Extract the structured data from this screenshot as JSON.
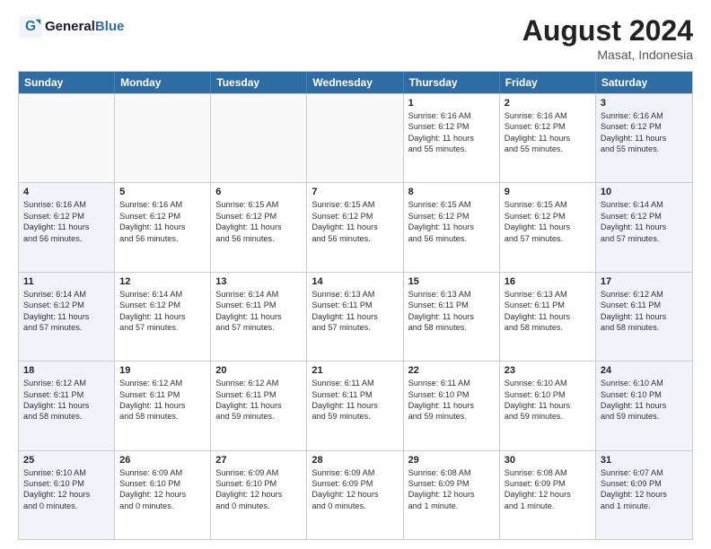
{
  "header": {
    "logo_general": "General",
    "logo_blue": "Blue",
    "month_year": "August 2024",
    "location": "Masat, Indonesia"
  },
  "weekdays": [
    "Sunday",
    "Monday",
    "Tuesday",
    "Wednesday",
    "Thursday",
    "Friday",
    "Saturday"
  ],
  "weeks": [
    [
      {
        "day": "",
        "lines": [],
        "empty": true
      },
      {
        "day": "",
        "lines": [],
        "empty": true
      },
      {
        "day": "",
        "lines": [],
        "empty": true
      },
      {
        "day": "",
        "lines": [],
        "empty": true
      },
      {
        "day": "1",
        "lines": [
          "Sunrise: 6:16 AM",
          "Sunset: 6:12 PM",
          "Daylight: 11 hours",
          "and 55 minutes."
        ]
      },
      {
        "day": "2",
        "lines": [
          "Sunrise: 6:16 AM",
          "Sunset: 6:12 PM",
          "Daylight: 11 hours",
          "and 55 minutes."
        ]
      },
      {
        "day": "3",
        "lines": [
          "Sunrise: 6:16 AM",
          "Sunset: 6:12 PM",
          "Daylight: 11 hours",
          "and 55 minutes."
        ]
      }
    ],
    [
      {
        "day": "4",
        "lines": [
          "Sunrise: 6:16 AM",
          "Sunset: 6:12 PM",
          "Daylight: 11 hours",
          "and 56 minutes."
        ]
      },
      {
        "day": "5",
        "lines": [
          "Sunrise: 6:16 AM",
          "Sunset: 6:12 PM",
          "Daylight: 11 hours",
          "and 56 minutes."
        ]
      },
      {
        "day": "6",
        "lines": [
          "Sunrise: 6:15 AM",
          "Sunset: 6:12 PM",
          "Daylight: 11 hours",
          "and 56 minutes."
        ]
      },
      {
        "day": "7",
        "lines": [
          "Sunrise: 6:15 AM",
          "Sunset: 6:12 PM",
          "Daylight: 11 hours",
          "and 56 minutes."
        ]
      },
      {
        "day": "8",
        "lines": [
          "Sunrise: 6:15 AM",
          "Sunset: 6:12 PM",
          "Daylight: 11 hours",
          "and 56 minutes."
        ]
      },
      {
        "day": "9",
        "lines": [
          "Sunrise: 6:15 AM",
          "Sunset: 6:12 PM",
          "Daylight: 11 hours",
          "and 57 minutes."
        ]
      },
      {
        "day": "10",
        "lines": [
          "Sunrise: 6:14 AM",
          "Sunset: 6:12 PM",
          "Daylight: 11 hours",
          "and 57 minutes."
        ]
      }
    ],
    [
      {
        "day": "11",
        "lines": [
          "Sunrise: 6:14 AM",
          "Sunset: 6:12 PM",
          "Daylight: 11 hours",
          "and 57 minutes."
        ]
      },
      {
        "day": "12",
        "lines": [
          "Sunrise: 6:14 AM",
          "Sunset: 6:12 PM",
          "Daylight: 11 hours",
          "and 57 minutes."
        ]
      },
      {
        "day": "13",
        "lines": [
          "Sunrise: 6:14 AM",
          "Sunset: 6:11 PM",
          "Daylight: 11 hours",
          "and 57 minutes."
        ]
      },
      {
        "day": "14",
        "lines": [
          "Sunrise: 6:13 AM",
          "Sunset: 6:11 PM",
          "Daylight: 11 hours",
          "and 57 minutes."
        ]
      },
      {
        "day": "15",
        "lines": [
          "Sunrise: 6:13 AM",
          "Sunset: 6:11 PM",
          "Daylight: 11 hours",
          "and 58 minutes."
        ]
      },
      {
        "day": "16",
        "lines": [
          "Sunrise: 6:13 AM",
          "Sunset: 6:11 PM",
          "Daylight: 11 hours",
          "and 58 minutes."
        ]
      },
      {
        "day": "17",
        "lines": [
          "Sunrise: 6:12 AM",
          "Sunset: 6:11 PM",
          "Daylight: 11 hours",
          "and 58 minutes."
        ]
      }
    ],
    [
      {
        "day": "18",
        "lines": [
          "Sunrise: 6:12 AM",
          "Sunset: 6:11 PM",
          "Daylight: 11 hours",
          "and 58 minutes."
        ]
      },
      {
        "day": "19",
        "lines": [
          "Sunrise: 6:12 AM",
          "Sunset: 6:11 PM",
          "Daylight: 11 hours",
          "and 58 minutes."
        ]
      },
      {
        "day": "20",
        "lines": [
          "Sunrise: 6:12 AM",
          "Sunset: 6:11 PM",
          "Daylight: 11 hours",
          "and 59 minutes."
        ]
      },
      {
        "day": "21",
        "lines": [
          "Sunrise: 6:11 AM",
          "Sunset: 6:11 PM",
          "Daylight: 11 hours",
          "and 59 minutes."
        ]
      },
      {
        "day": "22",
        "lines": [
          "Sunrise: 6:11 AM",
          "Sunset: 6:10 PM",
          "Daylight: 11 hours",
          "and 59 minutes."
        ]
      },
      {
        "day": "23",
        "lines": [
          "Sunrise: 6:10 AM",
          "Sunset: 6:10 PM",
          "Daylight: 11 hours",
          "and 59 minutes."
        ]
      },
      {
        "day": "24",
        "lines": [
          "Sunrise: 6:10 AM",
          "Sunset: 6:10 PM",
          "Daylight: 11 hours",
          "and 59 minutes."
        ]
      }
    ],
    [
      {
        "day": "25",
        "lines": [
          "Sunrise: 6:10 AM",
          "Sunset: 6:10 PM",
          "Daylight: 12 hours",
          "and 0 minutes."
        ]
      },
      {
        "day": "26",
        "lines": [
          "Sunrise: 6:09 AM",
          "Sunset: 6:10 PM",
          "Daylight: 12 hours",
          "and 0 minutes."
        ]
      },
      {
        "day": "27",
        "lines": [
          "Sunrise: 6:09 AM",
          "Sunset: 6:10 PM",
          "Daylight: 12 hours",
          "and 0 minutes."
        ]
      },
      {
        "day": "28",
        "lines": [
          "Sunrise: 6:09 AM",
          "Sunset: 6:09 PM",
          "Daylight: 12 hours",
          "and 0 minutes."
        ]
      },
      {
        "day": "29",
        "lines": [
          "Sunrise: 6:08 AM",
          "Sunset: 6:09 PM",
          "Daylight: 12 hours",
          "and 1 minute."
        ]
      },
      {
        "day": "30",
        "lines": [
          "Sunrise: 6:08 AM",
          "Sunset: 6:09 PM",
          "Daylight: 12 hours",
          "and 1 minute."
        ]
      },
      {
        "day": "31",
        "lines": [
          "Sunrise: 6:07 AM",
          "Sunset: 6:09 PM",
          "Daylight: 12 hours",
          "and 1 minute."
        ]
      }
    ]
  ]
}
